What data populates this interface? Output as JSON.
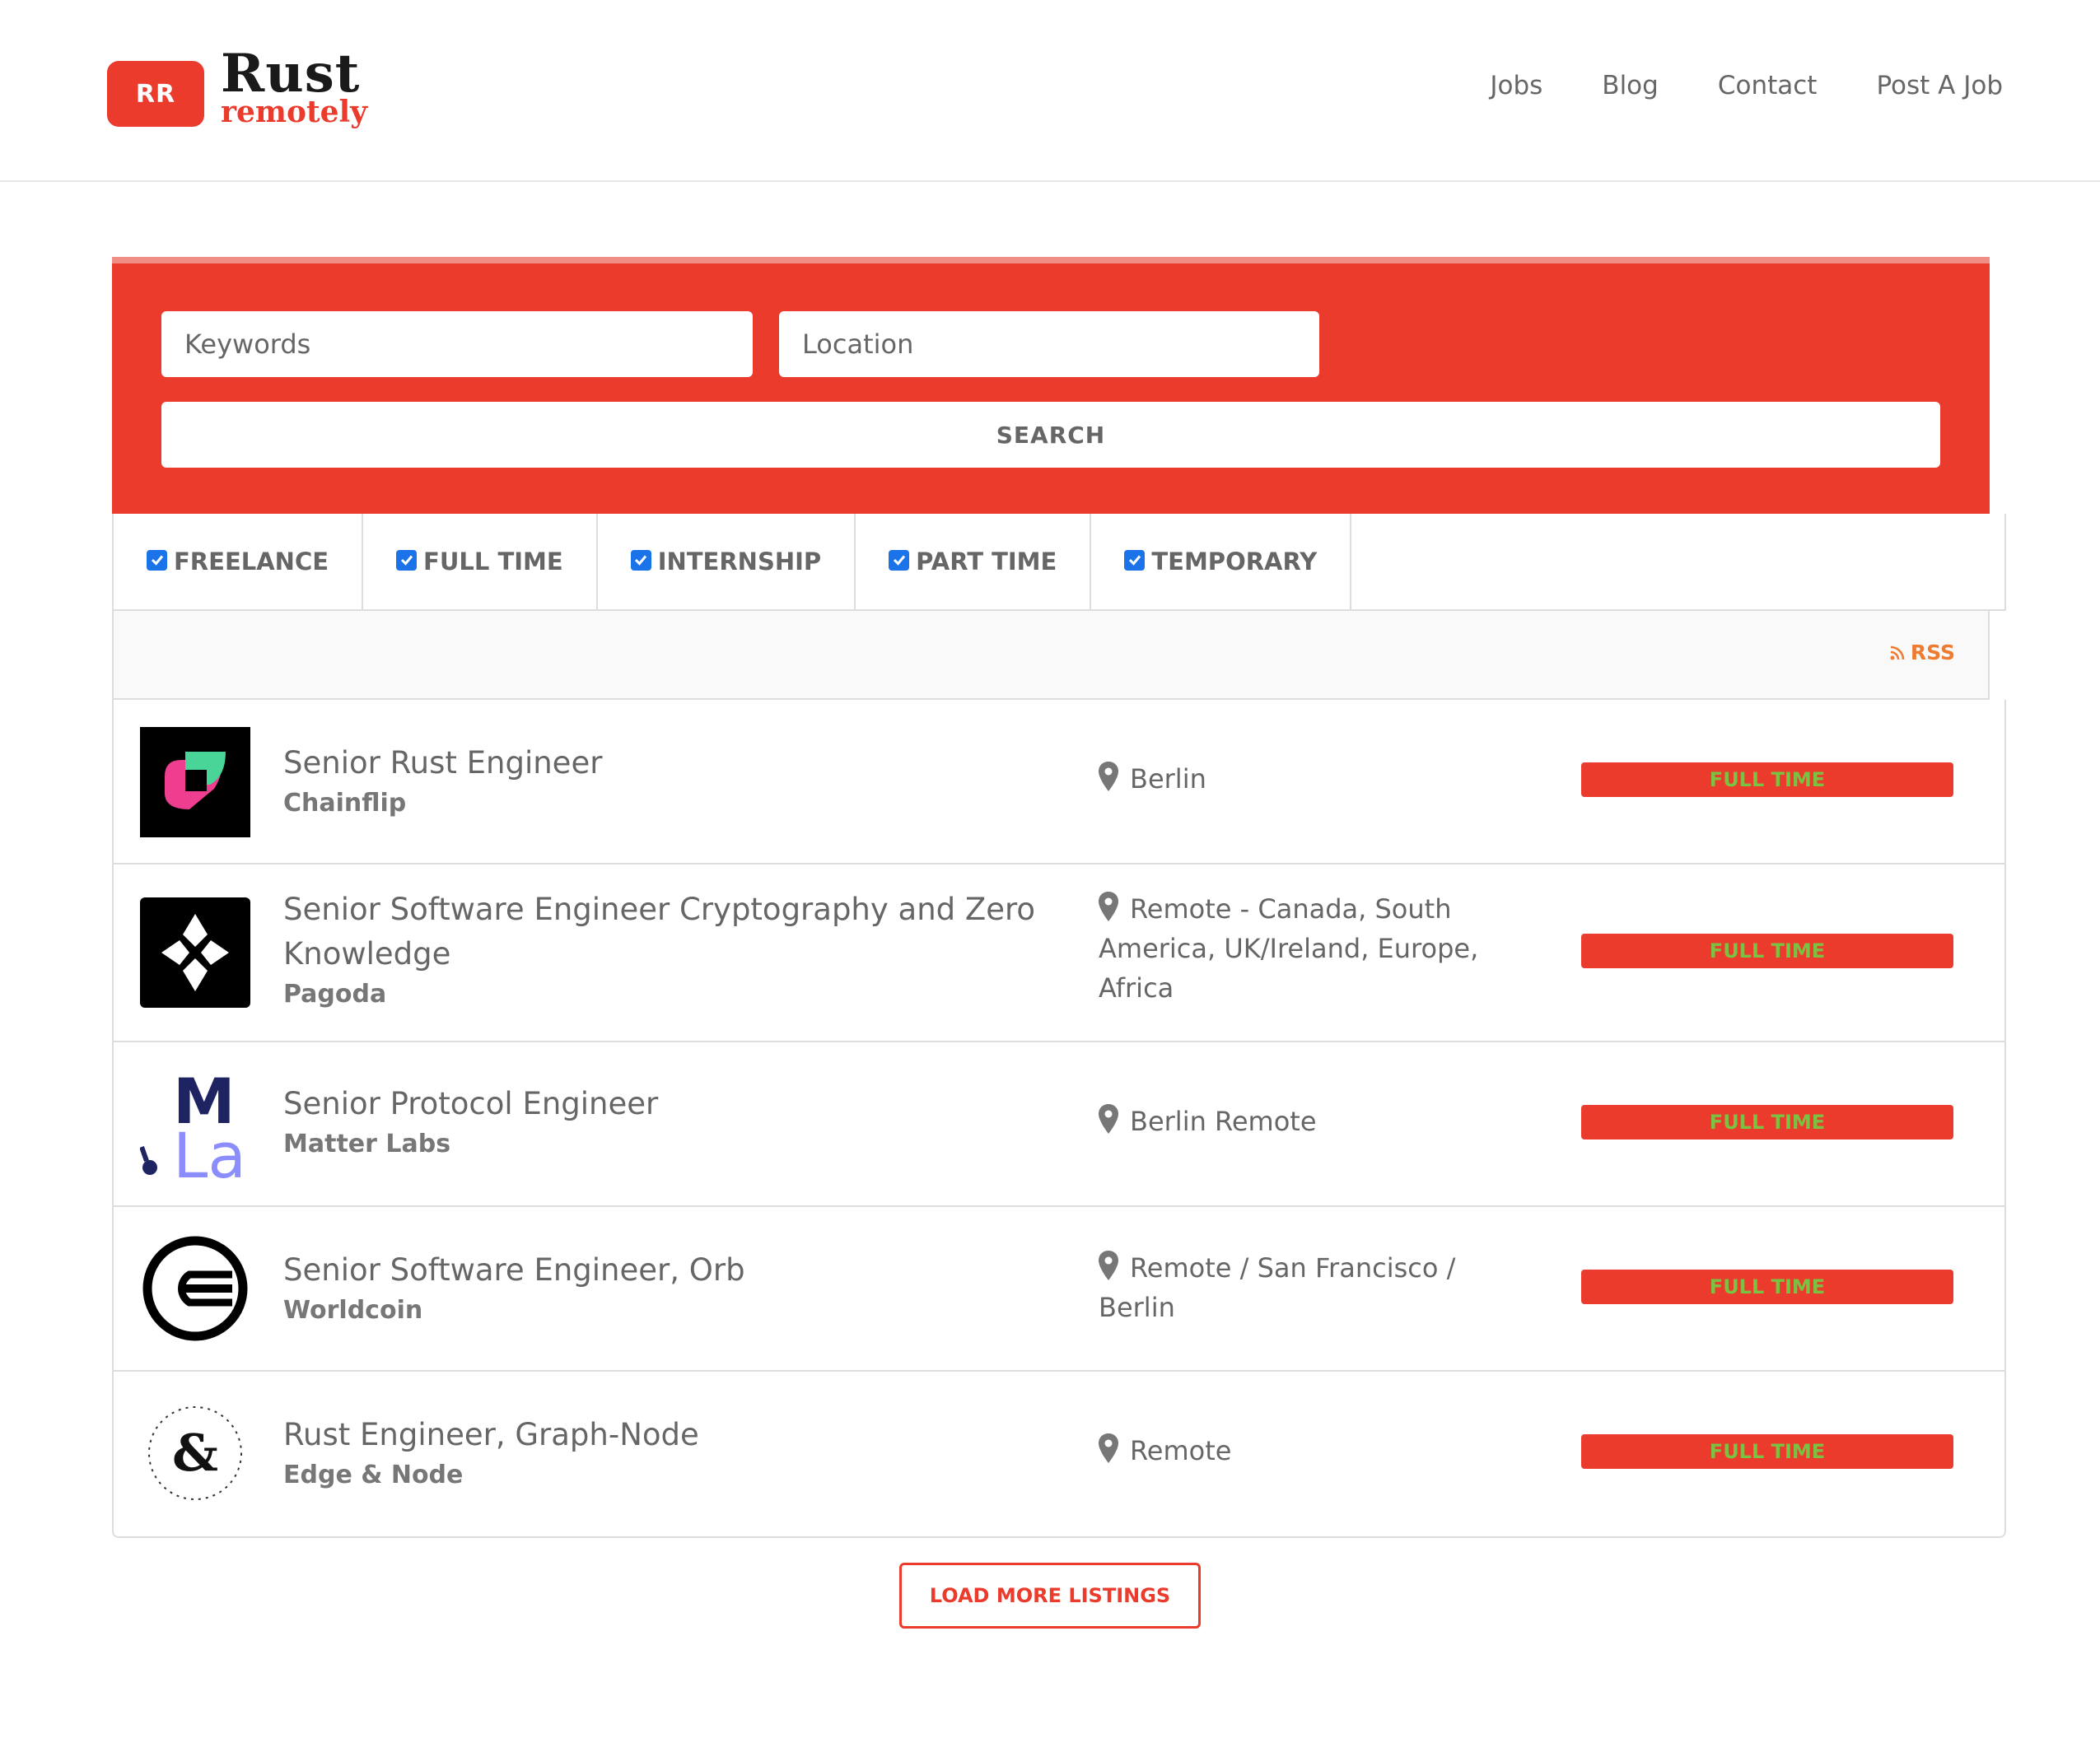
{
  "brand": {
    "badge": "RR",
    "name": "Rust",
    "tagline": "remotely",
    "color": "#ea3b2c"
  },
  "nav": {
    "items": [
      "Jobs",
      "Blog",
      "Contact",
      "Post A Job"
    ]
  },
  "search": {
    "keywords_placeholder": "Keywords",
    "keywords_value": "",
    "location_placeholder": "Location",
    "location_value": "",
    "button_label": "SEARCH"
  },
  "filters": [
    {
      "label": "FREELANCE",
      "checked": true
    },
    {
      "label": "FULL TIME",
      "checked": true
    },
    {
      "label": "INTERNSHIP",
      "checked": true
    },
    {
      "label": "PART TIME",
      "checked": true
    },
    {
      "label": "TEMPORARY",
      "checked": true
    }
  ],
  "rss_label": "RSS",
  "listings": [
    {
      "title": "Senior Rust Engineer",
      "company": "Chainflip",
      "location": "Berlin",
      "type": "FULL TIME",
      "logo_icon": "chainflip-logo"
    },
    {
      "title": "Senior Software Engineer Cryptography and Zero Knowledge",
      "company": "Pagoda",
      "location": "Remote - Canada, South America, UK/Ireland, Europe, Africa",
      "type": "FULL TIME",
      "logo_icon": "pagoda-logo"
    },
    {
      "title": "Senior Protocol Engineer",
      "company": "Matter Labs",
      "location": "Berlin Remote",
      "type": "FULL TIME",
      "logo_icon": "matter-labs-logo"
    },
    {
      "title": "Senior Software Engineer, Orb",
      "company": "Worldcoin",
      "location": "Remote / San Francisco / Berlin",
      "type": "FULL TIME",
      "logo_icon": "worldcoin-logo"
    },
    {
      "title": "Rust Engineer, Graph-Node",
      "company": "Edge & Node",
      "location": "Remote",
      "type": "FULL TIME",
      "logo_icon": "edge-and-node-logo"
    }
  ],
  "load_more_label": "LOAD MORE LISTINGS"
}
